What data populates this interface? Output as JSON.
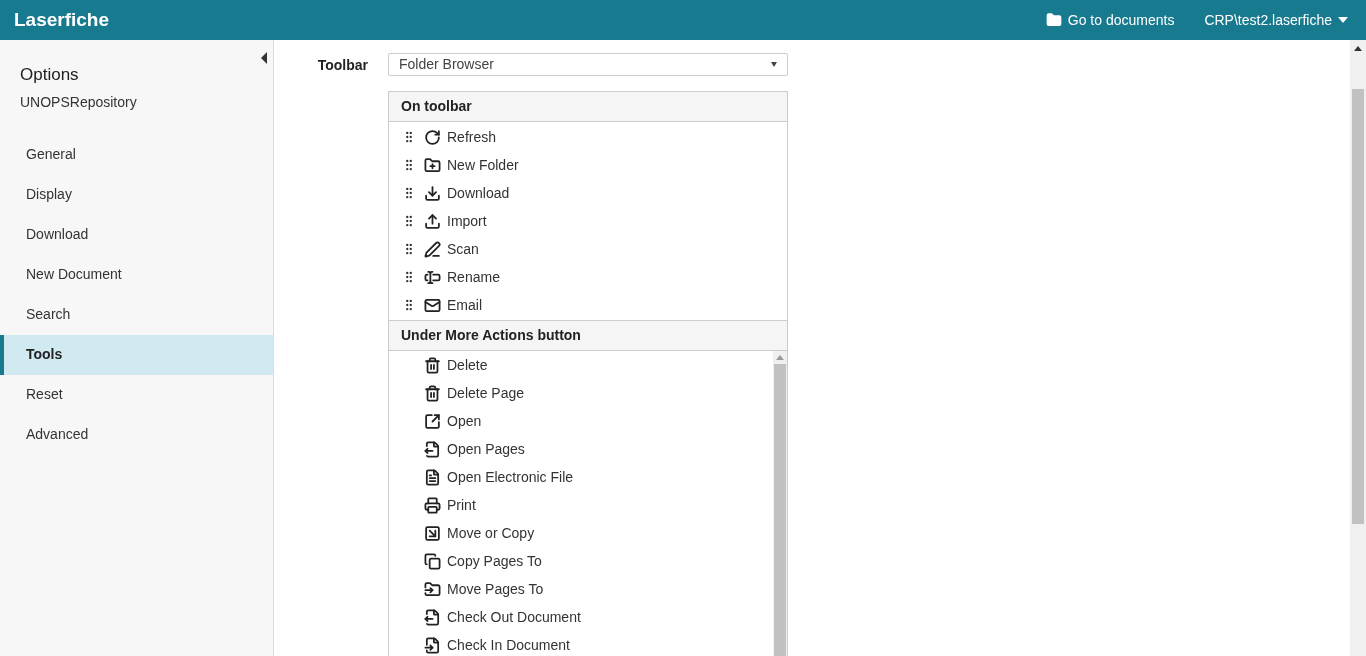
{
  "header": {
    "logo": "Laserfiche",
    "go_to_documents": "Go to documents",
    "user": "CRP\\test2.laserfiche"
  },
  "sidebar": {
    "title": "Options",
    "subtitle": "UNOPSRepository",
    "items": [
      {
        "label": "General",
        "selected": false
      },
      {
        "label": "Display",
        "selected": false
      },
      {
        "label": "Download",
        "selected": false
      },
      {
        "label": "New Document",
        "selected": false
      },
      {
        "label": "Search",
        "selected": false
      },
      {
        "label": "Tools",
        "selected": true
      },
      {
        "label": "Reset",
        "selected": false
      },
      {
        "label": "Advanced",
        "selected": false
      }
    ]
  },
  "toolbar": {
    "label": "Toolbar",
    "value": "Folder Browser"
  },
  "on_toolbar": {
    "heading": "On toolbar",
    "items": [
      "Refresh",
      "New Folder",
      "Download",
      "Import",
      "Scan",
      "Rename",
      "Email"
    ]
  },
  "more_actions": {
    "heading": "Under More Actions button",
    "items": [
      "Delete",
      "Delete Page",
      "Open",
      "Open Pages",
      "Open Electronic File",
      "Print",
      "Move or Copy",
      "Copy Pages To",
      "Move Pages To",
      "Check Out Document",
      "Check In Document"
    ]
  }
}
